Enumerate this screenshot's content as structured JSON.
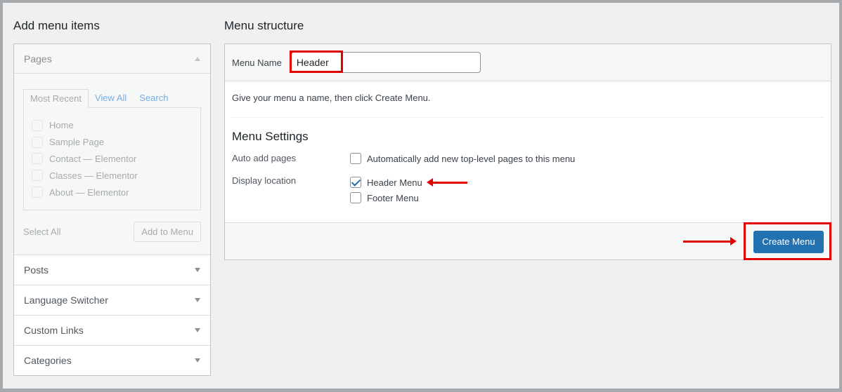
{
  "left_panel": {
    "title": "Add menu items",
    "pages_section": {
      "label": "Pages",
      "tabs": [
        "Most Recent",
        "View All",
        "Search"
      ],
      "items": [
        "Home",
        "Sample Page",
        "Contact — Elementor",
        "Classes — Elementor",
        "About — Elementor"
      ],
      "select_all": "Select All",
      "add_button": "Add to Menu"
    },
    "sections": [
      "Posts",
      "Language Switcher",
      "Custom Links",
      "Categories"
    ]
  },
  "right_panel": {
    "title": "Menu structure",
    "menu_name_label": "Menu Name",
    "menu_name_value": "Header",
    "instructions": "Give your menu a name, then click Create Menu.",
    "settings_title": "Menu Settings",
    "auto_add_label": "Auto add pages",
    "auto_add_option": "Automatically add new top-level pages to this menu",
    "display_location_label": "Display location",
    "locations": [
      {
        "label": "Header Menu",
        "checked": true
      },
      {
        "label": "Footer Menu",
        "checked": false
      }
    ],
    "create_button": "Create Menu"
  },
  "colors": {
    "annotation_red": "#e00000",
    "primary_blue": "#2271b1"
  }
}
